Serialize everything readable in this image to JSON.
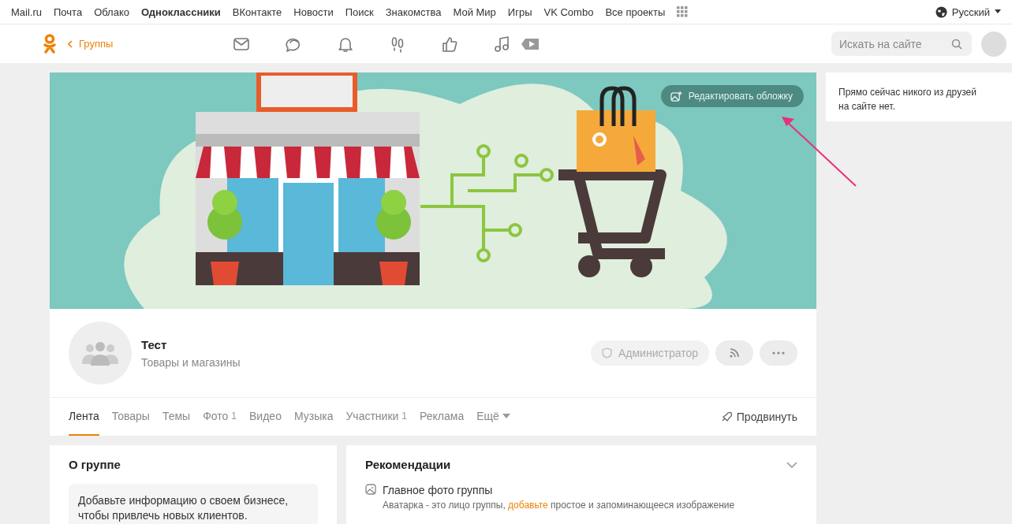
{
  "top_bar": {
    "links": [
      {
        "label": "Mail.ru",
        "selected": false
      },
      {
        "label": "Почта",
        "selected": false
      },
      {
        "label": "Облако",
        "selected": false
      },
      {
        "label": "Одноклассники",
        "selected": true
      },
      {
        "label": "ВКонтакте",
        "selected": false
      },
      {
        "label": "Новости",
        "selected": false
      },
      {
        "label": "Поиск",
        "selected": false
      },
      {
        "label": "Знакомства",
        "selected": false
      },
      {
        "label": "Мой Мир",
        "selected": false
      },
      {
        "label": "Игры",
        "selected": false
      },
      {
        "label": "VK Combo",
        "selected": false
      },
      {
        "label": "Все проекты",
        "selected": false
      }
    ],
    "language": "Русский"
  },
  "header": {
    "back_link": "Группы",
    "search": {
      "placeholder": "Искать на сайте"
    }
  },
  "cover": {
    "edit_button": "Редактировать обложку"
  },
  "group": {
    "name": "Тест",
    "category": "Товары и магазины",
    "admin_button": "Администратор"
  },
  "tabs": [
    {
      "label": "Лента",
      "selected": true
    },
    {
      "label": "Товары",
      "selected": false
    },
    {
      "label": "Темы",
      "selected": false
    },
    {
      "label": "Фото",
      "count": "1",
      "selected": false
    },
    {
      "label": "Видео",
      "selected": false
    },
    {
      "label": "Музыка",
      "selected": false
    },
    {
      "label": "Участники",
      "count": "1",
      "selected": false
    },
    {
      "label": "Реклама",
      "selected": false
    },
    {
      "label": "Ещё",
      "kind": "more",
      "selected": false
    }
  ],
  "promote": "Продвинуть",
  "about": {
    "title": "О группе",
    "text": "Добавьте информацию о своем бизнесе, чтобы привлечь новых клиентов."
  },
  "recommendations": {
    "title": "Рекомендации",
    "items": [
      {
        "title": "Главное фото группы",
        "text_before": "Аватарка - это лицо группы, ",
        "link": "добавьте",
        "text_after": " простое и запоминающееся изображение"
      }
    ]
  },
  "friends_online": "Прямо сейчас никого из друзей на сайте нет."
}
